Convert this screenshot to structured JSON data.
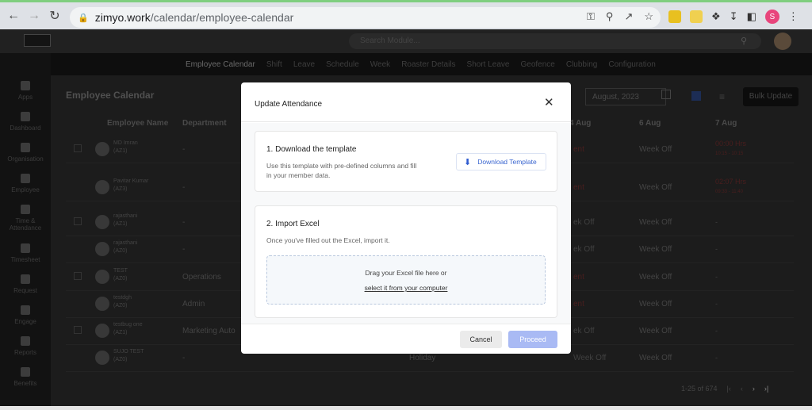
{
  "browser": {
    "url_host": "zimyo.work",
    "url_path": "/calendar/employee-calendar",
    "profile_initial": "S"
  },
  "app": {
    "search_placeholder": "Search Module...",
    "subnav": [
      "Employee Calendar",
      "Shift",
      "Leave",
      "Schedule",
      "Week",
      "Roaster Details",
      "Short Leave",
      "Geofence",
      "Clubbing",
      "Configuration"
    ],
    "sidebar": [
      "Apps",
      "Dashboard",
      "Organisation",
      "Employee",
      "Time & Attendance",
      "Timesheet",
      "Request",
      "Engage",
      "Reports",
      "Benefits"
    ]
  },
  "page": {
    "title": "Employee Calendar",
    "month": "August, 2023",
    "bulk_update": "Bulk Update",
    "columns": [
      "Employee Name",
      "Department",
      "4 Aug",
      "6 Aug",
      "7 Aug"
    ],
    "rows": [
      {
        "name": "MD Imran",
        "code": "(AZ1)",
        "dept": "-",
        "c5": "ent",
        "c6": "Week Off",
        "c7a": "00:00 Hrs",
        "c7b": "10:15 - 10:15"
      },
      {
        "name": "Pavitar Kumar",
        "code": "(AZ3)",
        "dept": "-",
        "c5": "ent",
        "c6": "Week Off",
        "c7a": "02:07 Hrs",
        "c7b": "09:33 - 11:40"
      },
      {
        "name": "rajasthani",
        "code": "(AZ1)",
        "dept": "-",
        "c5": "ek Off",
        "c6": "Week Off",
        "c7a": "-",
        "c7b": ""
      },
      {
        "name": "rajasthani",
        "code": "(AZ0)",
        "dept": "-",
        "c5": "ek Off",
        "c6": "Week Off",
        "c7a": "-",
        "c7b": ""
      },
      {
        "name": "TEST",
        "code": "(AZ0)",
        "dept": "Operations",
        "c5": "ent",
        "c6": "Week Off",
        "c7a": "-",
        "c7b": ""
      },
      {
        "name": "testdgh",
        "code": "(AZ0)",
        "dept": "Admin",
        "c5": "ent",
        "c6": "Week Off",
        "c7a": "-",
        "c7b": ""
      },
      {
        "name": "testbug one",
        "code": "(AZ1)",
        "dept": "Marketing Auto",
        "c5": "ek Off",
        "c6": "Week Off",
        "c7a": "-",
        "c7b": ""
      },
      {
        "name": "SUJO TEST",
        "code": "(AZ0)",
        "dept": "-",
        "c4": "Holiday",
        "c5": "Week Off",
        "c6": "Week Off",
        "c7a": "-",
        "c7b": ""
      }
    ],
    "pagination": "1-25 of 674"
  },
  "modal": {
    "title": "Update Attendance",
    "step1_title": "1. Download the template",
    "step1_desc": "Use this template with pre-defined columns and fill in your member data.",
    "download_label": "Download Template",
    "step2_title": "2. Import Excel",
    "step2_desc": "Once you've filled out the Excel, import it.",
    "drop_text": "Drag your Excel file here or",
    "drop_link": "select it from your computer",
    "cancel_label": "Cancel",
    "proceed_label": "Proceed"
  },
  "colors": {
    "accent": "#3a66d0",
    "proceed_bg": "#a9baf4"
  }
}
